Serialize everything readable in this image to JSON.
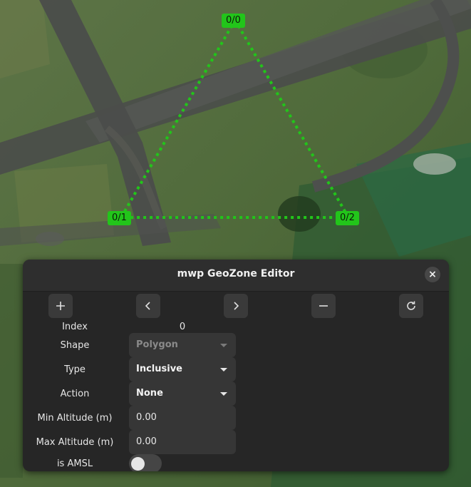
{
  "map": {
    "points": [
      {
        "label": "0/0"
      },
      {
        "label": "0/1"
      },
      {
        "label": "0/2"
      }
    ],
    "line_color": "#22c51a"
  },
  "dialog": {
    "title": "mwp GeoZone Editor",
    "close_label": "×",
    "toolbar": {
      "add_icon": "plus-icon",
      "prev_icon": "chevron-left-icon",
      "next_icon": "chevron-right-icon",
      "remove_icon": "minus-icon",
      "refresh_icon": "refresh-icon"
    },
    "fields": {
      "index_label": "Index",
      "index_value": "0",
      "shape_label": "Shape",
      "shape_value": "Polygon",
      "type_label": "Type",
      "type_value": "Inclusive",
      "action_label": "Action",
      "action_value": "None",
      "min_alt_label": "Min Altitude (m)",
      "min_alt_value": "0.00",
      "max_alt_label": "Max Altitude (m)",
      "max_alt_value": "0.00",
      "amsl_label": "is AMSL",
      "amsl_on": false
    }
  }
}
